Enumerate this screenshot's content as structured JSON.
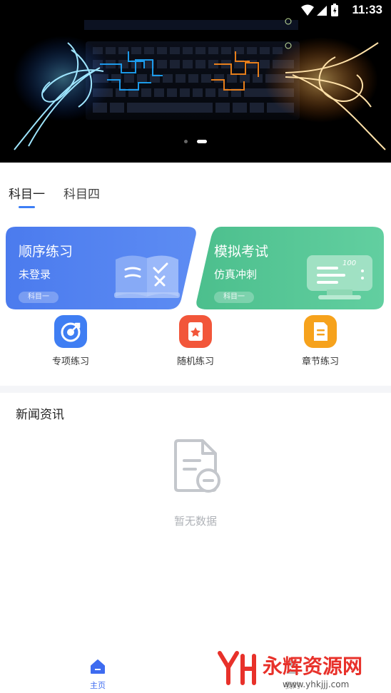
{
  "status_bar": {
    "time": "11:33"
  },
  "banner": {
    "slides": 2,
    "active_slide": 2
  },
  "tabs": [
    {
      "label": "科目一",
      "active": true
    },
    {
      "label": "科目四",
      "active": false
    }
  ],
  "cards": {
    "sequential": {
      "title": "顺序练习",
      "subtitle": "未登录",
      "tag": "科目一",
      "color": "#4a78ea"
    },
    "mock_exam": {
      "title": "模拟考试",
      "subtitle": "仿真冲刺",
      "tag": "科目一",
      "color": "#4fc292"
    }
  },
  "quick_actions": [
    {
      "label": "专项练习",
      "icon": "target-icon",
      "color": "#3f7ef3"
    },
    {
      "label": "随机练习",
      "icon": "card-icon",
      "color": "#f2563a"
    },
    {
      "label": "章节练习",
      "icon": "document-icon",
      "color": "#f6a21c"
    }
  ],
  "news": {
    "title": "新闻资讯",
    "empty_text": "暂无数据"
  },
  "bottom_nav": {
    "home_label": "主页",
    "mine_label": "我的",
    "accent": "#3d6bf0"
  },
  "watermark": {
    "brand": "永辉资源网",
    "url": "www.yhkjjj.com"
  }
}
